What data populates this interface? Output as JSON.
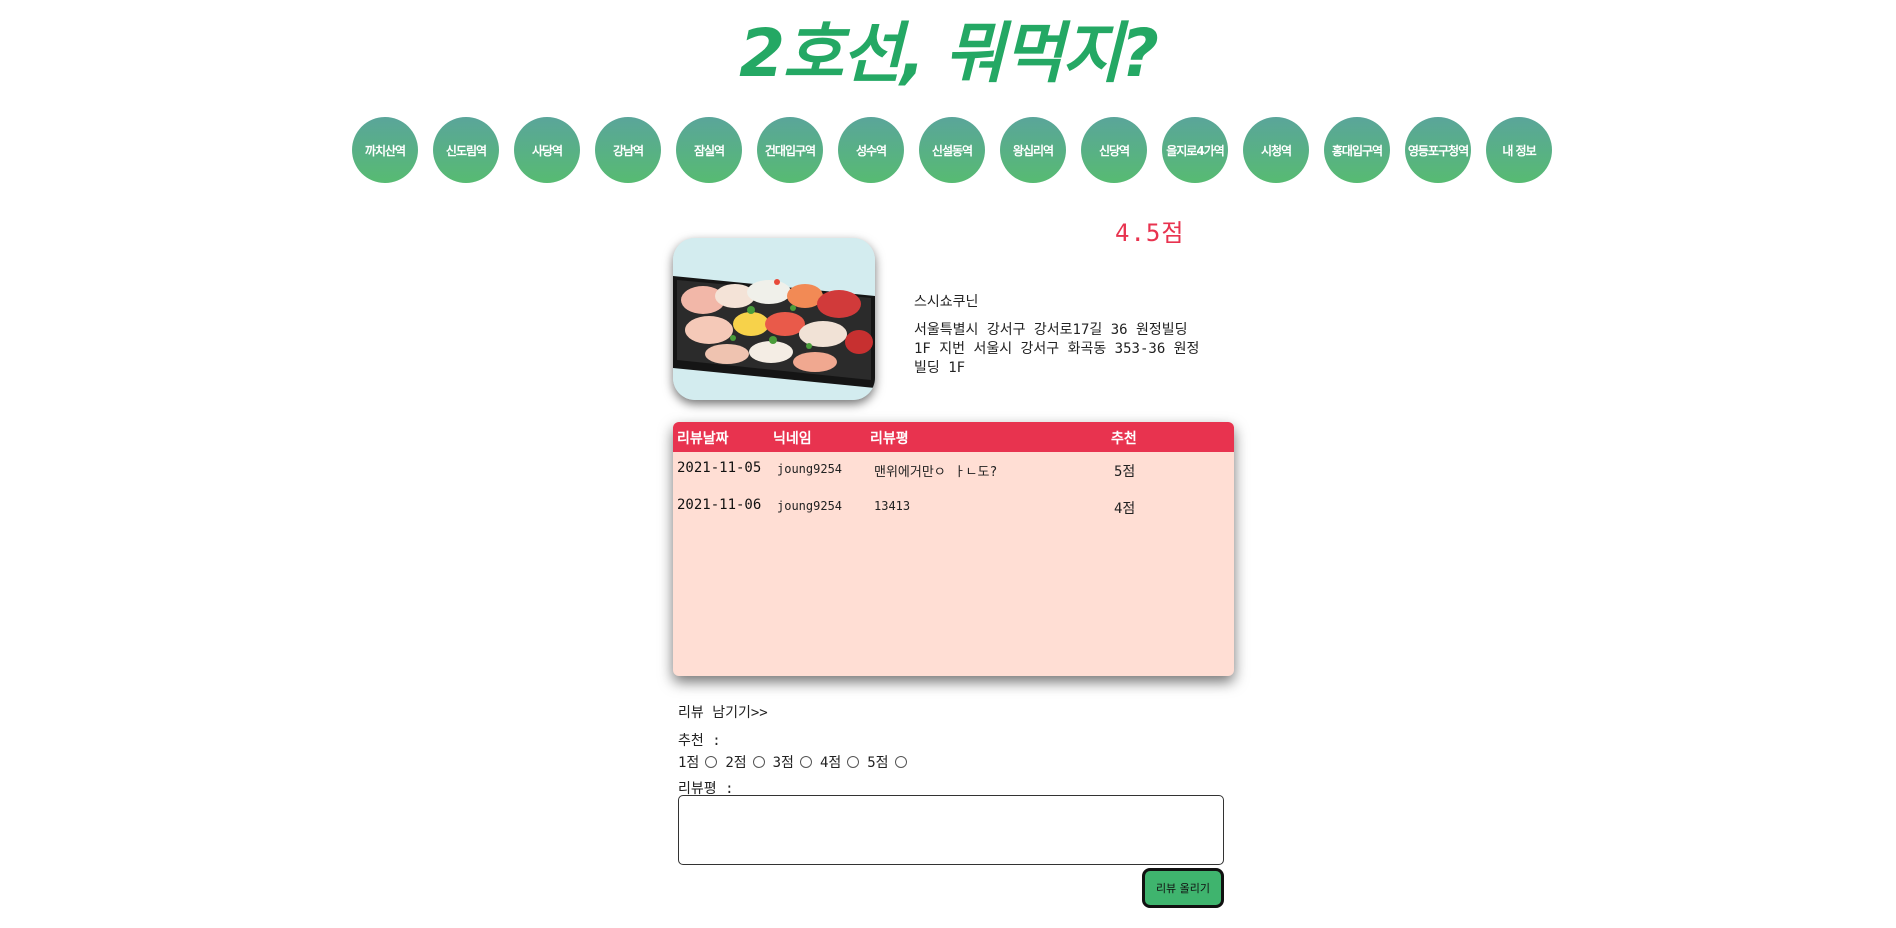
{
  "header": {
    "logo_text": "2호선, 뭐먹지?"
  },
  "nav": {
    "stations": [
      "까치산역",
      "신도림역",
      "사당역",
      "강남역",
      "잠실역",
      "건대입구역",
      "성수역",
      "신설동역",
      "왕십리역",
      "신당역",
      "을지로4가역",
      "시청역",
      "홍대입구역",
      "영등포구청역",
      "내 정보"
    ]
  },
  "restaurant": {
    "score": "4.5점",
    "name": "스시쇼쿠닌",
    "address": "서울특별시 강서구 강서로17길 36 원정빌딩 1F 지번 서울시 강서구 화곡동 353-36 원정빌딩 1F",
    "photo_icon": "sushi-photo"
  },
  "reviews": {
    "headers": {
      "date": "리뷰날짜",
      "nickname": "닉네임",
      "review": "리뷰평",
      "rating": "추천"
    },
    "rows": [
      {
        "date": "2021-11-05",
        "nickname": "joung9254",
        "review": "맨위에거만ㅇ ㅏㄴ도?",
        "rating": "5점"
      },
      {
        "date": "2021-11-06",
        "nickname": "joung9254",
        "review": "13413",
        "rating": "4점"
      }
    ]
  },
  "form": {
    "title": "리뷰 남기기>>",
    "rating_label": "추천 :",
    "options": [
      "1점",
      "2점",
      "3점",
      "4점",
      "5점"
    ],
    "review_label": "리뷰평 :",
    "review_value": "",
    "submit_label": "리뷰 올리기"
  },
  "colors": {
    "accent_green": "#24a864",
    "accent_red": "#e8334f",
    "review_bg": "#ffded4"
  }
}
